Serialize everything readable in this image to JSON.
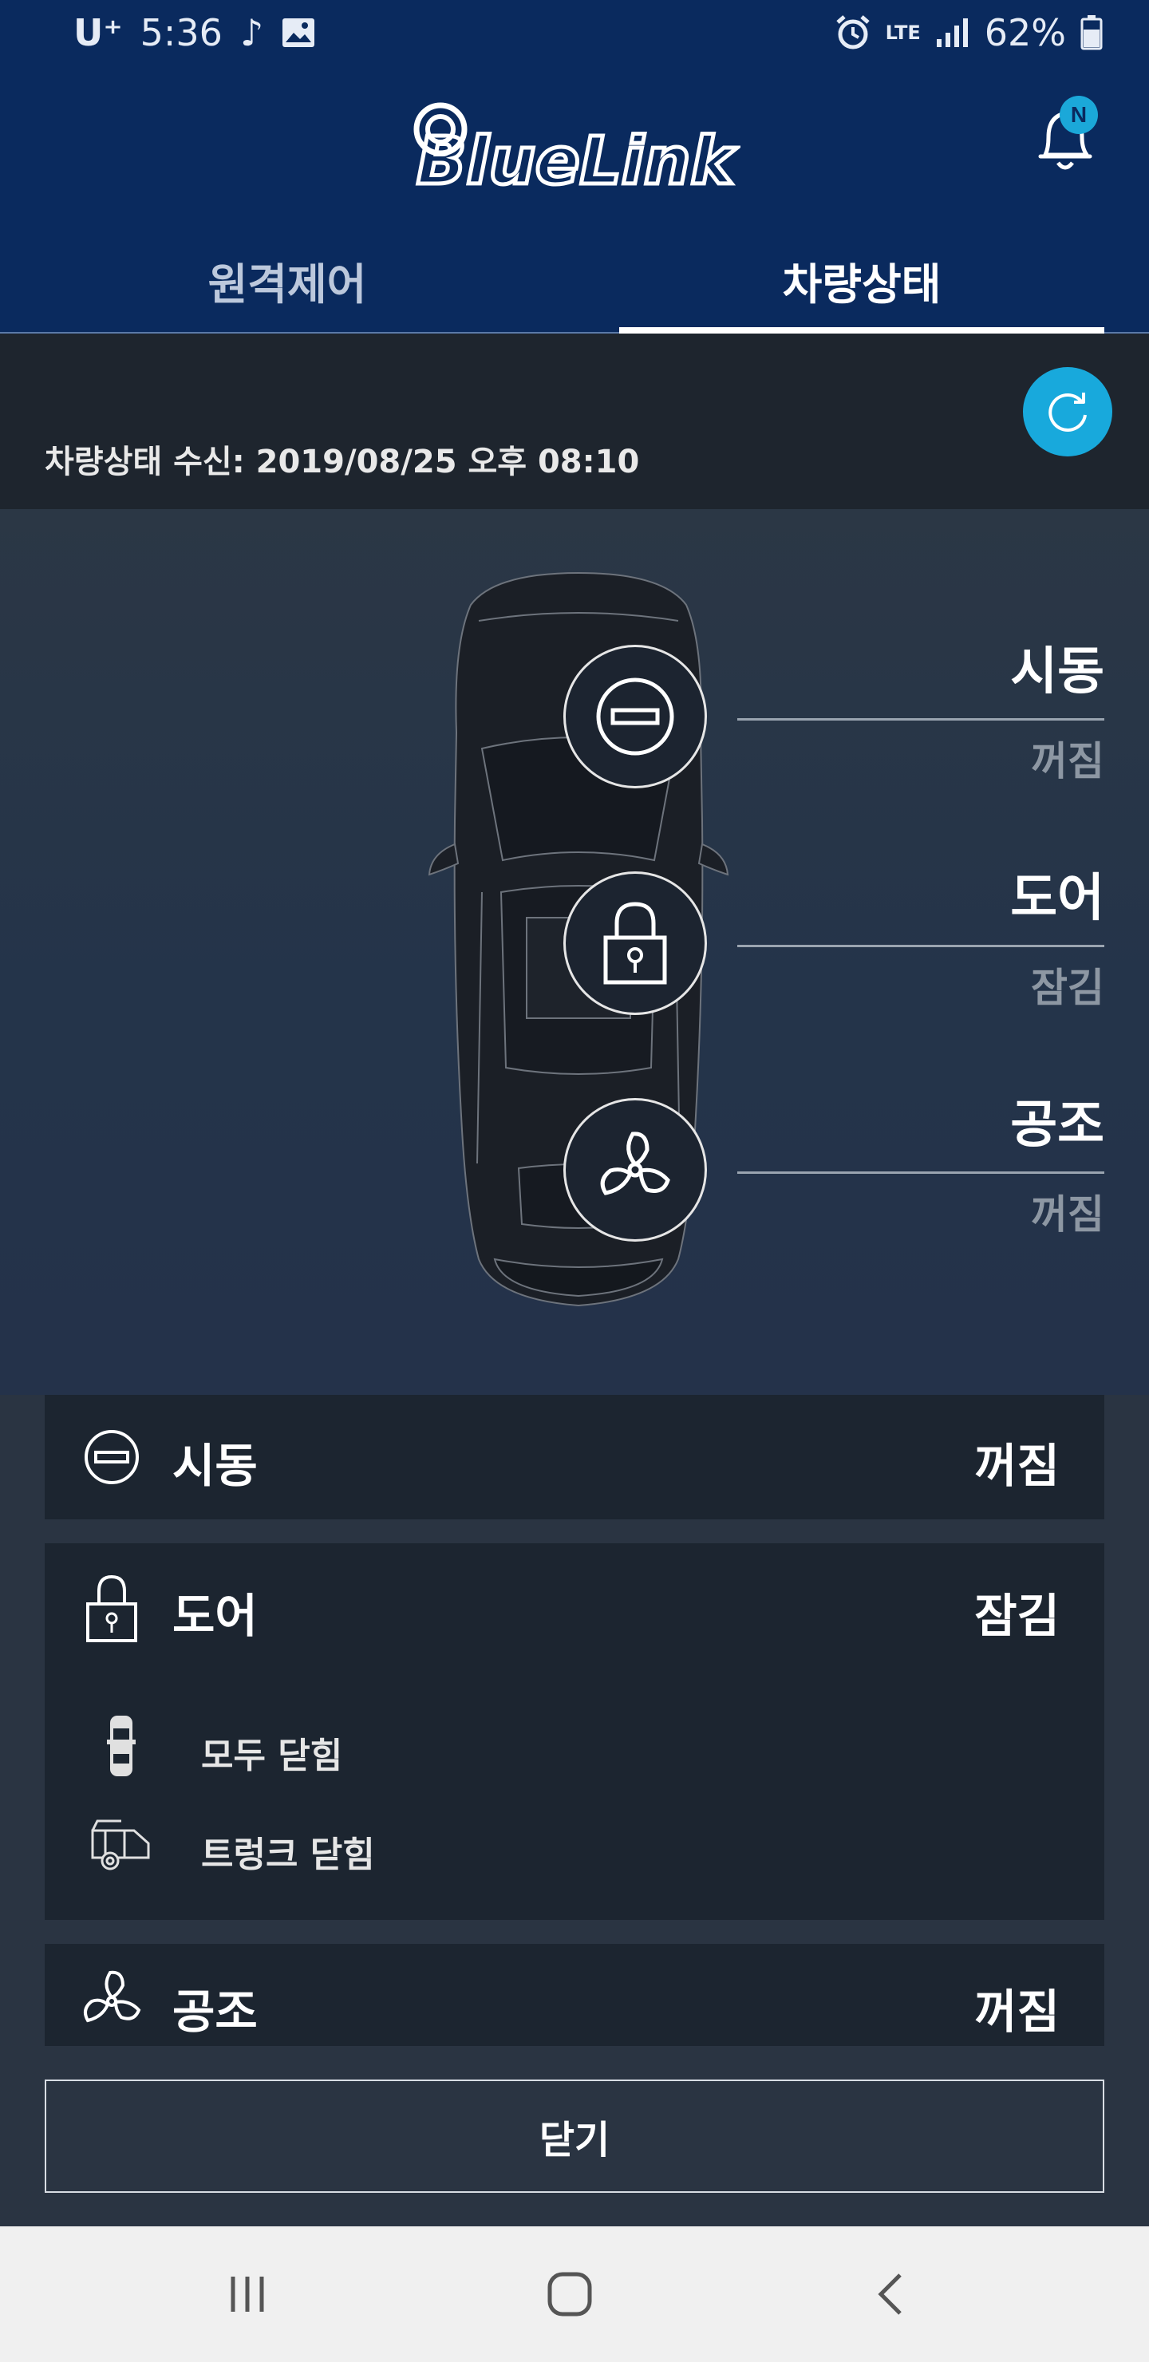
{
  "status_bar": {
    "carrier": "U⁺",
    "time": "5:36",
    "network": "LTE",
    "battery": "62%"
  },
  "header": {
    "logo_text": "BlueLink",
    "notification_badge": "N",
    "tabs": [
      {
        "label": "원격제어",
        "active": false
      },
      {
        "label": "차량상태",
        "active": true
      }
    ]
  },
  "info": {
    "received": "차량상태 수신: 2019/08/25 오후 08:10"
  },
  "vehicle_callouts": [
    {
      "title": "시동",
      "value": "꺼짐"
    },
    {
      "title": "도어",
      "value": "잠김"
    },
    {
      "title": "공조",
      "value": "꺼짐"
    }
  ],
  "list": {
    "engine": {
      "label": "시동",
      "value": "꺼짐"
    },
    "door": {
      "label": "도어",
      "value": "잠김",
      "details": [
        {
          "label": "모두 닫힘",
          "icon": "car-top-icon"
        },
        {
          "label": "트렁크 닫힘",
          "icon": "trunk-icon"
        }
      ]
    },
    "climate": {
      "label": "공조",
      "value": "꺼짐"
    }
  },
  "close_button": "닫기",
  "colors": {
    "header_bg": "#0a2a5e",
    "accent": "#18a9dc",
    "card_bg": "#1c2530",
    "page_bg": "#2a3442"
  }
}
